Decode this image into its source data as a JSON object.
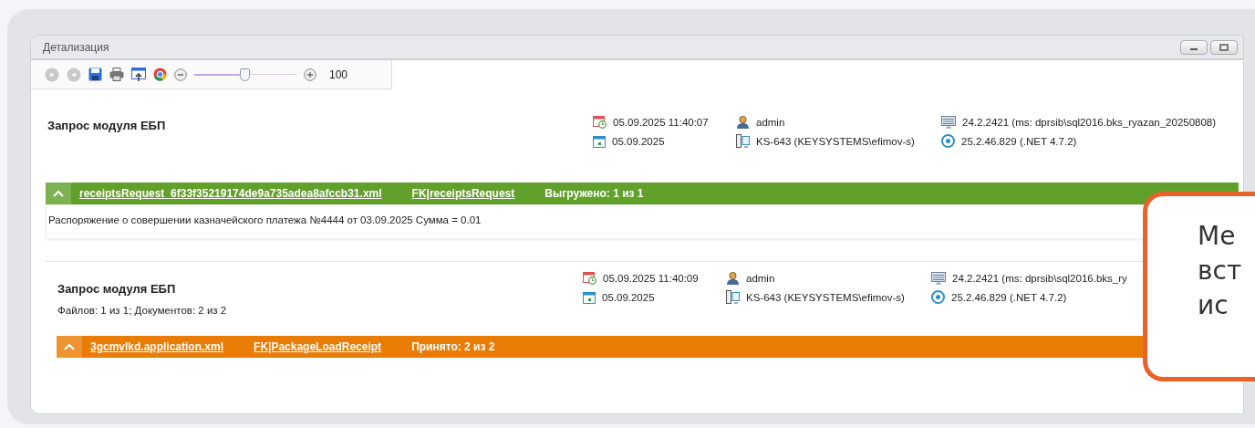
{
  "window": {
    "title": "Детализация"
  },
  "toolbar": {
    "zoom": {
      "level": 0.5,
      "value": "100"
    }
  },
  "requests": [
    {
      "title": "Запрос модуля ЕБП",
      "meta": [
        {
          "kind": "created",
          "text": "05.09.2025 11:40:07"
        },
        {
          "kind": "user",
          "text": "admin"
        },
        {
          "kind": "server",
          "text": "24.2.2421 (ms: dprsib\\sql2016.bks_ryazan_20250808)"
        },
        {
          "kind": "date",
          "text": "05.09.2025"
        },
        {
          "kind": "machine",
          "text": "KS-643 (KEYSYSTEMS\\efimov-s)"
        },
        {
          "kind": "version",
          "text": "25.2.46.829 (.NET 4.7.2)"
        }
      ],
      "bar": {
        "color": "#62a02c",
        "expanded": true,
        "file": "receiptsRequest_6f33f35219174de9a735adea8afccb31.xml",
        "type": "FK|receiptsRequest",
        "status": "Выгружено: 1 из 1"
      },
      "description": "Распоряжение о совершении казначейского платежа №4444 от 03.09.2025 Сумма = 0.01"
    },
    {
      "title": "Запрос модуля ЕБП",
      "summary": "Файлов: 1 из 1; Документов: 2 из 2",
      "meta": [
        {
          "kind": "created",
          "text": "05.09.2025 11:40:09"
        },
        {
          "kind": "user",
          "text": "admin"
        },
        {
          "kind": "server",
          "text": "24.2.2421 (ms: dprsib\\sql2016.bks_ry"
        },
        {
          "kind": "date",
          "text": "05.09.2025"
        },
        {
          "kind": "machine",
          "text": "KS-643 (KEYSYSTEMS\\efimov-s)"
        },
        {
          "kind": "version",
          "text": "25.2.46.829 (.NET 4.7.2)"
        }
      ],
      "bar": {
        "color": "#e87c05",
        "expanded": true,
        "file": "3gcmvlkd.application.xml",
        "type": "FK|PackageLoadReceipt",
        "status": "Принято: 2 из 2"
      }
    }
  ],
  "callout": {
    "lines": [
      "Ме",
      "вст",
      "ис"
    ]
  }
}
